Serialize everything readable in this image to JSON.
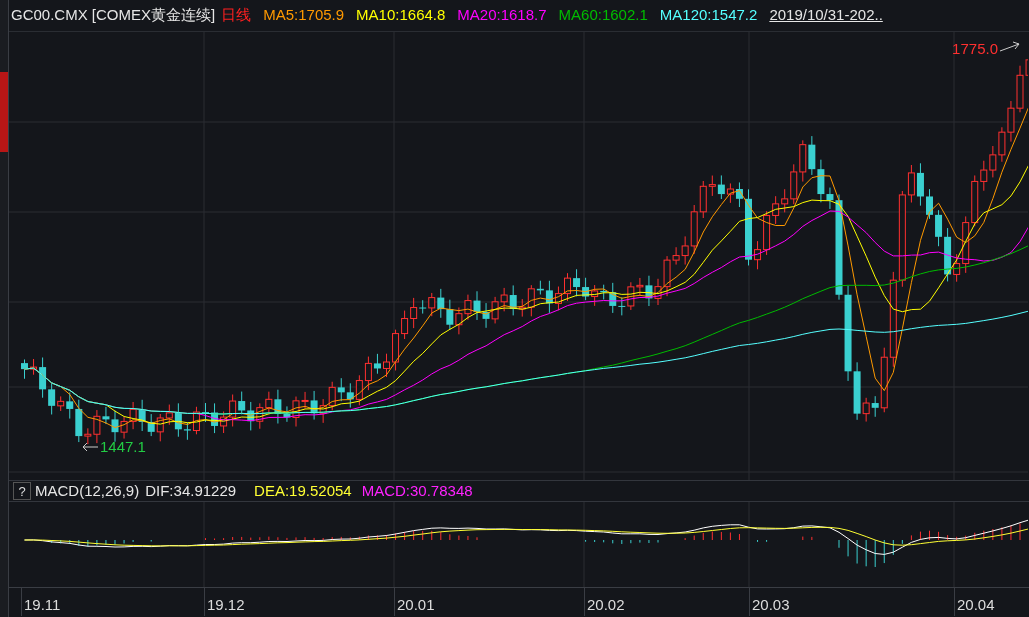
{
  "header": {
    "symbol": "GC00.CMX [COMEX黄金连续]",
    "period": "日线",
    "moving_averages": [
      {
        "label": "MA5:1705.9",
        "color": "#ff9900"
      },
      {
        "label": "MA10:1664.8",
        "color": "#ffff00"
      },
      {
        "label": "MA20:1618.7",
        "color": "#ff00ff"
      },
      {
        "label": "MA60:1602.1",
        "color": "#00bb00"
      },
      {
        "label": "MA120:1547.2",
        "color": "#55ffff"
      }
    ],
    "date_range": "2019/10/31-202.."
  },
  "price_chart": {
    "high_label": "1775.0",
    "low_label": "1447.1"
  },
  "macd": {
    "help": "?",
    "title": "MACD(12,26,9)",
    "dif": "DIF:34.91229",
    "dea": "DEA:19.52054",
    "value": "MACD:30.78348"
  },
  "time_axis": [
    "19.11",
    "19.12",
    "20.01",
    "20.02",
    "20.03",
    "20.04"
  ]
}
